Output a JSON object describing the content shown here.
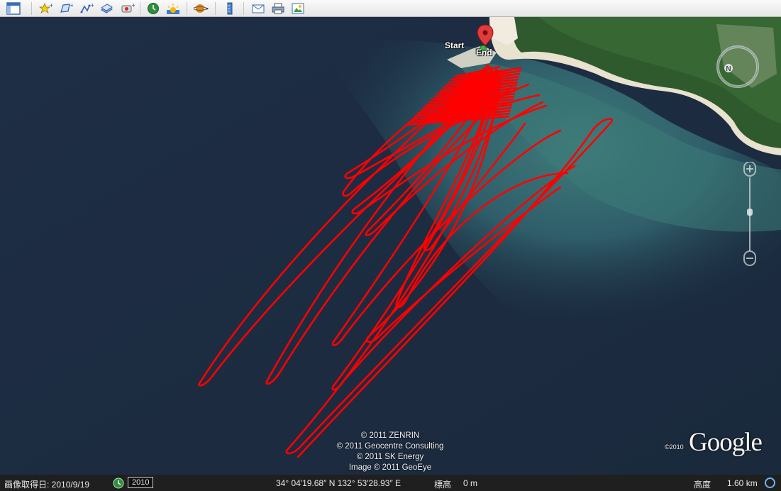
{
  "toolbar": {
    "buttons": [
      {
        "name": "sidebar-toggle-icon"
      },
      {
        "name": "add-placemark-icon"
      },
      {
        "name": "add-polygon-icon"
      },
      {
        "name": "add-path-icon"
      },
      {
        "name": "add-image-overlay-icon"
      },
      {
        "name": "record-tour-icon"
      },
      {
        "name": "historical-imagery-icon"
      },
      {
        "name": "sunlight-icon"
      },
      {
        "name": "planet-switch-icon"
      },
      {
        "name": "ruler-icon"
      },
      {
        "name": "email-icon"
      },
      {
        "name": "print-icon"
      },
      {
        "name": "save-image-icon"
      }
    ]
  },
  "map": {
    "start_label": "Start",
    "end_label": "End",
    "credits": [
      "© 2011 ZENRIN",
      "© 2011 Geocentre Consulting",
      "© 2011 SK Energy",
      "Image © 2011 GeoEye"
    ],
    "copyright_year": "©2010",
    "logo_text": "Google",
    "track_color": "#ff0000",
    "compass_letter": "N"
  },
  "statusbar": {
    "imagery_date": "画像取得日: 2010/9/19",
    "year_badge": "2010",
    "coordinates": "34° 04′19.68″ N 132° 53′28.93″ E",
    "elevation_label": "標高",
    "elevation_value": "0 m",
    "eye_alt_label": "高度",
    "eye_alt_value": "1.60 km"
  }
}
